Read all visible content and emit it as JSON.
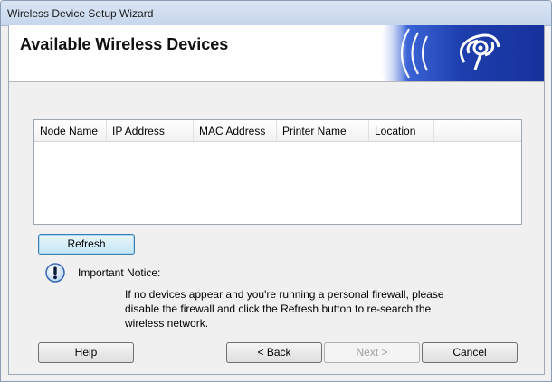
{
  "window": {
    "title": "Wireless Device Setup Wizard"
  },
  "header": {
    "title": "Available Wireless Devices",
    "logo_icon": "wireless-signal-icon"
  },
  "device_list": {
    "columns": [
      "Node Name",
      "IP Address",
      "MAC Address",
      "Printer Name",
      "Location"
    ],
    "rows": []
  },
  "buttons": {
    "refresh": "Refresh",
    "help": "Help",
    "back": "< Back",
    "next": "Next >",
    "cancel": "Cancel"
  },
  "notice": {
    "icon": "exclamation-icon",
    "title": "Important Notice:",
    "lines": [
      "If no devices appear and you're running a personal firewall, please",
      "disable the firewall and click the Refresh button to re-search the",
      "wireless network."
    ]
  },
  "colors": {
    "header_blue": "#1f3fa8",
    "accent_blue": "#2c5fd0"
  }
}
